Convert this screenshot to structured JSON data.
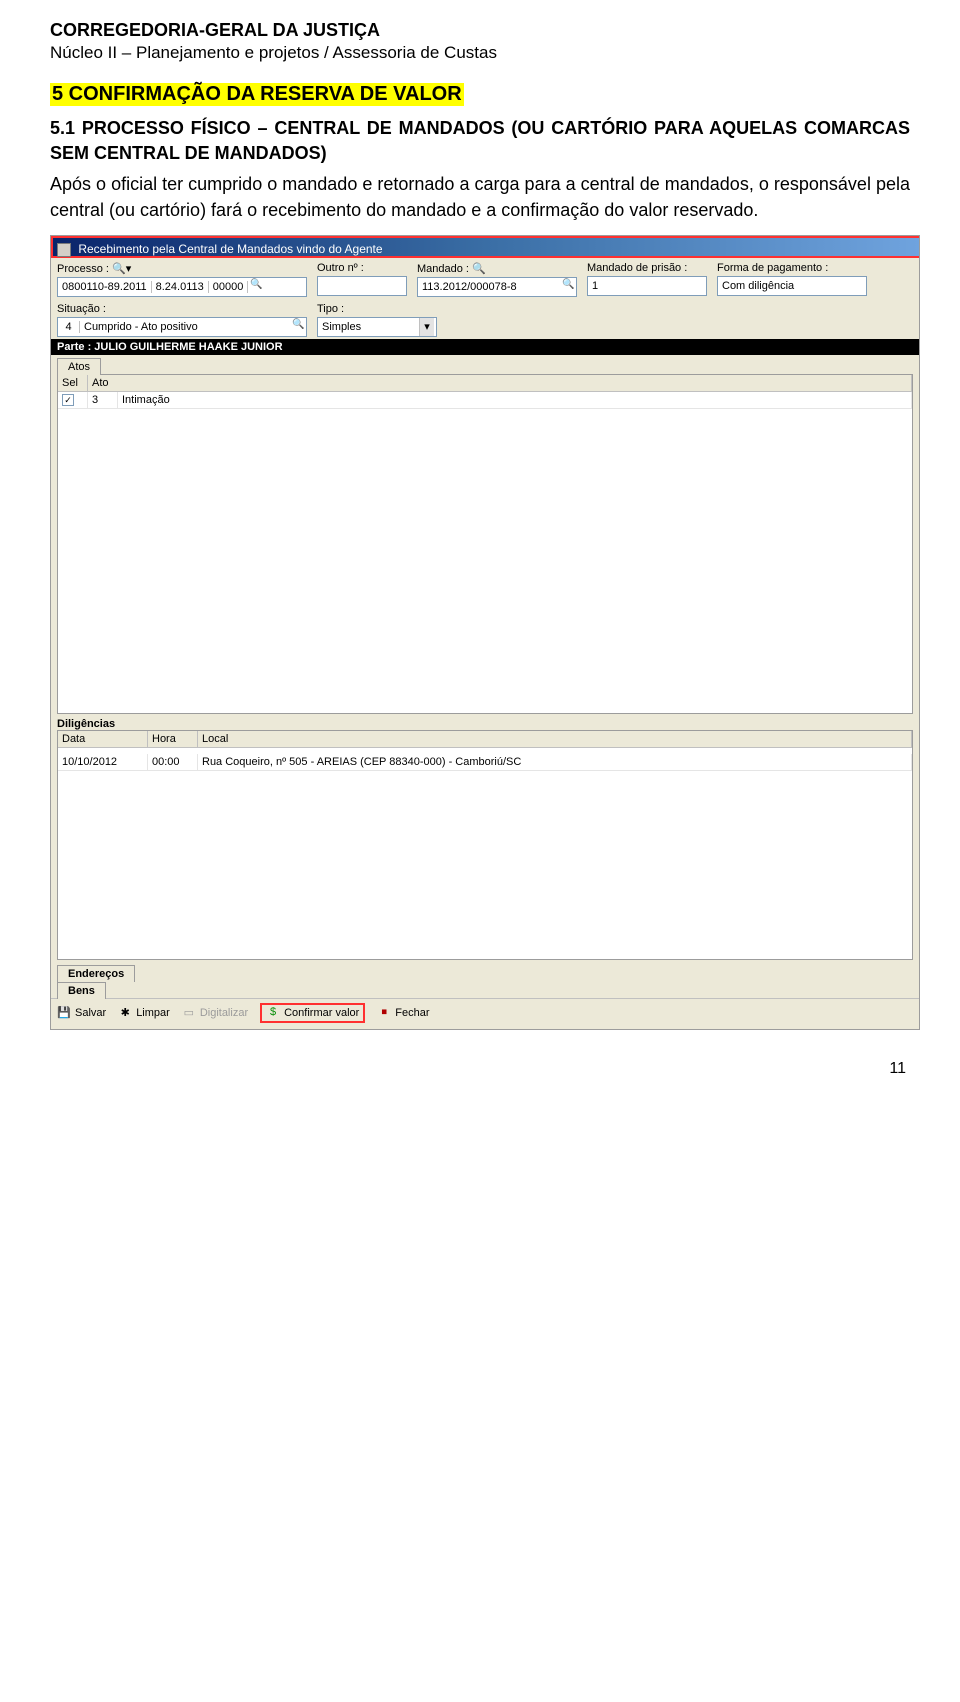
{
  "header": {
    "title": "CORREGEDORIA-GERAL DA JUSTIÇA",
    "subtitle": "Núcleo II – Planejamento e projetos / Assessoria de Custas"
  },
  "section": {
    "heading": "5 CONFIRMAÇÃO DA RESERVA DE VALOR",
    "sub_heading": "5.1 PROCESSO FÍSICO – CENTRAL DE MANDADOS (OU CARTÓRIO PARA AQUELAS COMARCAS SEM CENTRAL DE MANDADOS)",
    "body": "Após o oficial ter cumprido o mandado e retornado a carga para a central de mandados, o responsável pela central (ou cartório) fará o recebimento do mandado e a confirmação do valor reservado."
  },
  "shot": {
    "window_title": "Recebimento pela Central de Mandados vindo do Agente",
    "labels": {
      "processo": "Processo : ",
      "outro_n": "Outro nº :",
      "mandado": "Mandado : ",
      "mandado_prisao": "Mandado de prisão :",
      "forma_pagamento": "Forma de pagamento :",
      "situacao": "Situação :",
      "tipo": "Tipo :"
    },
    "fields": {
      "processo_cells": [
        "0800110-89.2011",
        "8.24.0113",
        "00000"
      ],
      "outro_n": "",
      "mandado": "113.2012/000078-8",
      "mandado_prisao": "1",
      "forma_pagamento": "Com diligência",
      "situacao_code": "4",
      "situacao_desc": "Cumprido - Ato positivo",
      "tipo": "Simples"
    },
    "parte_bar": "Parte : JULIO GUILHERME HAAKE JUNIOR",
    "tabs": {
      "atos": "Atos"
    },
    "atos_grid": {
      "headers": {
        "sel": "Sel",
        "ato": "Ato"
      },
      "row": {
        "checked": "✓",
        "num": "3",
        "desc": "Intimação"
      }
    },
    "dilig_label": "Diligências",
    "dilig_grid": {
      "headers": {
        "data": "Data",
        "hora": "Hora",
        "local": "Local"
      },
      "row": {
        "data": "10/10/2012",
        "hora": "00:00",
        "local": "Rua Coqueiro, nº 505 - AREIAS (CEP 88340-000) - Camboriú/SC"
      }
    },
    "extra_tabs": {
      "enderecos": "Endereços",
      "bens": "Bens"
    },
    "toolbar": {
      "salvar": "Salvar",
      "limpar": "Limpar",
      "digitalizar": "Digitalizar",
      "confirmar_valor": "Confirmar valor",
      "fechar": "Fechar"
    }
  },
  "page_number": "11"
}
